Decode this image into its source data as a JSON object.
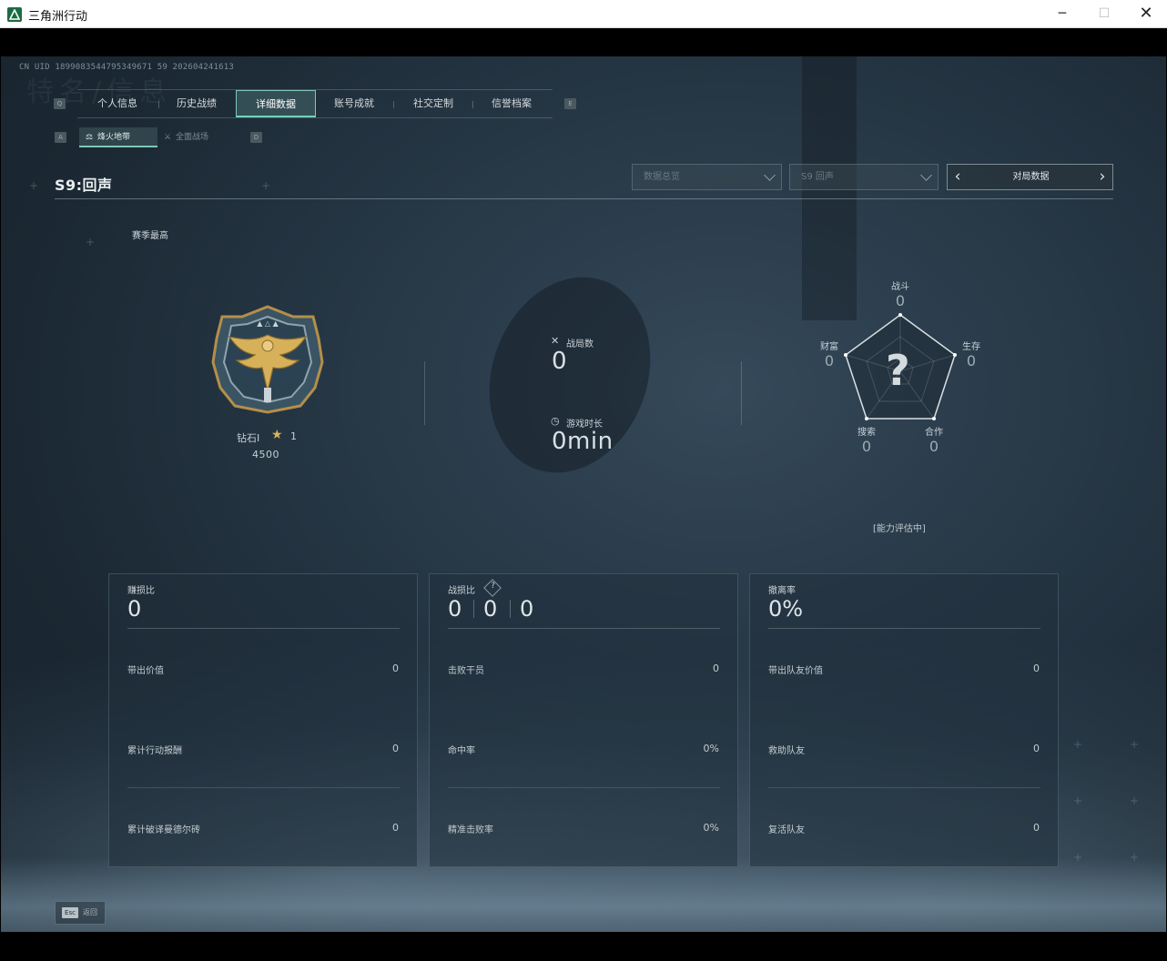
{
  "window": {
    "title": "三角洲行动",
    "controls": {
      "minimize": "─",
      "maximize": "☐",
      "close": "✕"
    }
  },
  "header": {
    "uid": "CN UID 1899083544795349671 59 202604241613",
    "ghost_title": "特名/信息"
  },
  "tabs": {
    "left_key": "Q",
    "right_key": "E",
    "items": [
      {
        "label": "个人信息"
      },
      {
        "label": "历史战绩"
      },
      {
        "label": "详细数据"
      },
      {
        "label": "账号成就"
      },
      {
        "label": "社交定制"
      },
      {
        "label": "信誉档案"
      }
    ],
    "active_index": 2
  },
  "subtabs": {
    "left_key": "A",
    "right_key": "D",
    "items": [
      {
        "label": "烽火地带",
        "icon": "⚖"
      },
      {
        "label": "全面战场",
        "icon": "⚔"
      }
    ],
    "active_index": 0
  },
  "section": {
    "title": "S9:回声",
    "dropdown_data": "数据总览",
    "dropdown_season": "S9 回声",
    "pager_label": "对局数据",
    "prev_arrow": "‹",
    "next_arrow": "›"
  },
  "rank": {
    "season_best_label": "赛季最高",
    "name": "钻石I",
    "star_icon": "★",
    "stars": "1",
    "score": "4500"
  },
  "summary": {
    "matches_icon": "✕",
    "matches_label": "战局数",
    "matches_value": "0",
    "playtime_icon": "◷",
    "playtime_label": "游戏时长",
    "playtime_value": "0min"
  },
  "radar": {
    "combat_label": "战斗",
    "combat_value": "0",
    "survival_label": "生存",
    "survival_value": "0",
    "teamwork_label": "合作",
    "teamwork_value": "0",
    "search_label": "搜索",
    "search_value": "0",
    "wealth_label": "财富",
    "wealth_value": "0",
    "unknown_mark": "?",
    "status": "[能力评估中]"
  },
  "cards": [
    {
      "title": "赚损比",
      "big": "0",
      "rows": [
        {
          "label": "带出价值",
          "value": "0"
        },
        {
          "label": "累计行动报酬",
          "value": "0"
        },
        {
          "label": "累计破译曼德尔砖",
          "value": "0"
        }
      ]
    },
    {
      "title": "战损比",
      "help": "?",
      "big_parts": [
        "0",
        "0",
        "0"
      ],
      "rows": [
        {
          "label": "击败干员",
          "value": "0"
        },
        {
          "label": "命中率",
          "value": "0%"
        },
        {
          "label": "精准击败率",
          "value": "0%"
        }
      ]
    },
    {
      "title": "撤离率",
      "big": "0%",
      "rows": [
        {
          "label": "带出队友价值",
          "value": "0"
        },
        {
          "label": "救助队友",
          "value": "0"
        },
        {
          "label": "复活队友",
          "value": "0"
        }
      ]
    }
  ],
  "footer": {
    "esc_key": "Esc",
    "esc_label": "返回"
  },
  "colors": {
    "accent": "#6fd4b8",
    "background": "#1b2833",
    "medal_gold": "#d9b35c"
  }
}
